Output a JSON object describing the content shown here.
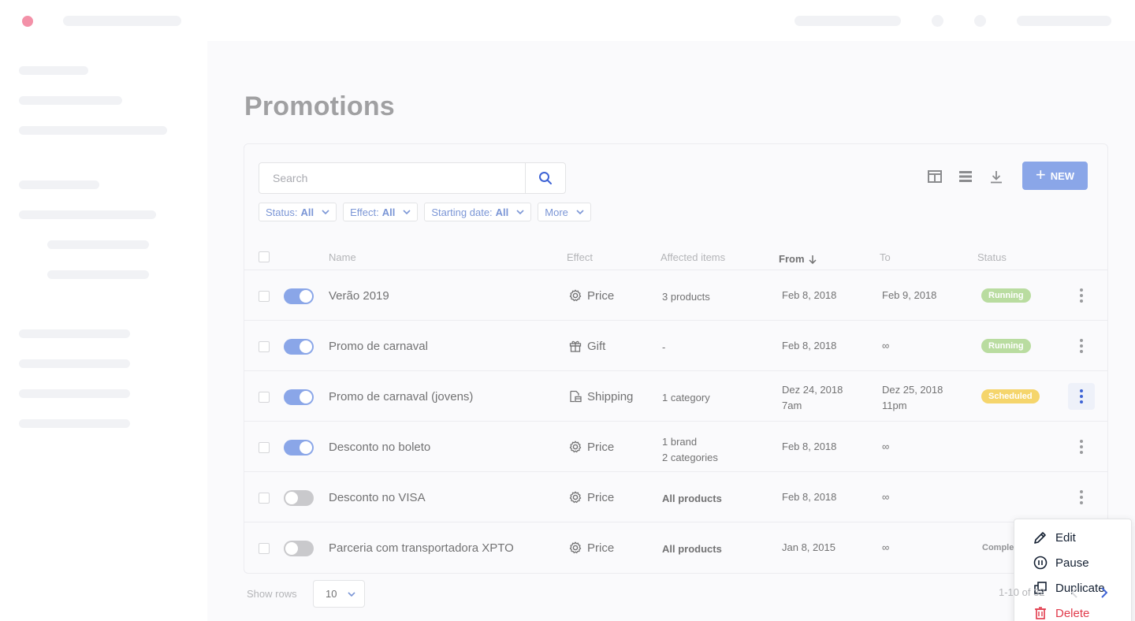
{
  "page": {
    "title": "Promotions"
  },
  "search": {
    "placeholder": "Search"
  },
  "toolbar": {
    "new_label": "NEW"
  },
  "filters": [
    {
      "label": "Status:",
      "value": "All"
    },
    {
      "label": "Effect:",
      "value": "All"
    },
    {
      "label": "Starting date:",
      "value": "All"
    },
    {
      "label": "More",
      "value": ""
    }
  ],
  "table": {
    "columns": [
      "Name",
      "Effect",
      "Affected items",
      "From",
      "To",
      "Status"
    ],
    "rows": [
      {
        "active": true,
        "name": "Verão 2019",
        "effect": "Price",
        "effect_icon": "gear-icon",
        "affected": [
          "3 products"
        ],
        "affected_bold": false,
        "from": [
          "Feb 8, 2018"
        ],
        "to": [
          "Feb 9, 2018"
        ],
        "status": "Running",
        "status_type": "running"
      },
      {
        "active": true,
        "name": "Promo de carnaval",
        "effect": "Gift",
        "effect_icon": "gift-icon",
        "affected": [
          "-"
        ],
        "affected_bold": false,
        "from": [
          "Feb 8, 2018"
        ],
        "to": [
          "∞"
        ],
        "status": "Running",
        "status_type": "running"
      },
      {
        "active": true,
        "name": "Promo de carnaval (jovens)",
        "effect": "Shipping",
        "effect_icon": "shipping-icon",
        "affected": [
          "1 category"
        ],
        "affected_bold": false,
        "from": [
          "Dez 24, 2018",
          "7am"
        ],
        "to": [
          "Dez 25, 2018",
          "11pm"
        ],
        "status": "Scheduled",
        "status_type": "scheduled"
      },
      {
        "active": true,
        "name": "Desconto no boleto",
        "effect": "Price",
        "effect_icon": "gear-icon",
        "affected": [
          "1 brand",
          "2 categories"
        ],
        "affected_bold": false,
        "from": [
          "Feb 8, 2018"
        ],
        "to": [
          "∞"
        ],
        "status": "",
        "status_type": "none"
      },
      {
        "active": false,
        "name": "Desconto no VISA",
        "effect": "Price",
        "effect_icon": "gear-icon",
        "affected": [
          "All products"
        ],
        "affected_bold": true,
        "from": [
          "Feb 8, 2018"
        ],
        "to": [
          "∞"
        ],
        "status": "",
        "status_type": "none"
      },
      {
        "active": false,
        "name": "Parceria com transportadora XPTO",
        "effect": "Price",
        "effect_icon": "gear-icon",
        "affected": [
          "All products"
        ],
        "affected_bold": true,
        "from": [
          "Jan 8, 2015"
        ],
        "to": [
          "∞"
        ],
        "status": "Completed",
        "status_type": "completed"
      }
    ]
  },
  "context_menu": {
    "edit": "Edit",
    "pause": "Pause",
    "duplicate": "Duplicate",
    "delete": "Delete"
  },
  "footer": {
    "show_rows_label": "Show rows",
    "rows_value": "10",
    "range_text": "1-10 of 32"
  },
  "colors": {
    "accent": "#8aa6e8",
    "running": "#b9dca0",
    "scheduled": "#f5d56c",
    "danger": "#e1394a"
  }
}
